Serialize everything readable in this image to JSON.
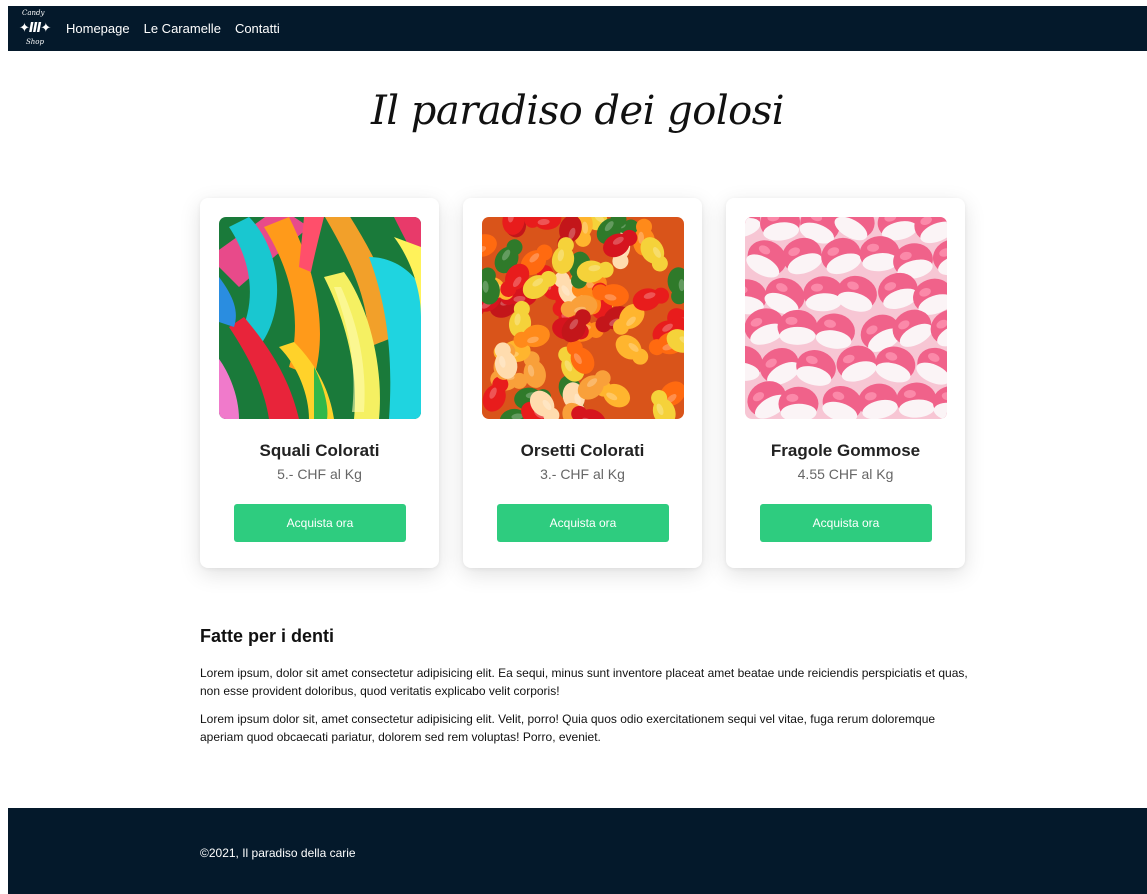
{
  "navbar": {
    "logo": {
      "top_text": "Candy",
      "bottom_text": "Shop",
      "mark": "✦III✦"
    },
    "links": [
      {
        "label": "Homepage"
      },
      {
        "label": "Le Caramelle"
      },
      {
        "label": "Contatti"
      }
    ],
    "background": "#04192b"
  },
  "hero": {
    "title": "Il paradiso dei golosi"
  },
  "products": [
    {
      "name": "Squali Colorati",
      "price": "5.- CHF al Kg",
      "button": "Acquista ora",
      "image": "colorful-gummy-sharks"
    },
    {
      "name": "Orsetti Colorati",
      "price": "3.- CHF al Kg",
      "button": "Acquista ora",
      "image": "colorful-gummy-bears"
    },
    {
      "name": "Fragole Gommose",
      "price": "4.55 CHF al Kg",
      "button": "Acquista ora",
      "image": "pink-white-strawberry-gummies"
    }
  ],
  "about": {
    "title": "Fatte per i denti",
    "paragraphs": [
      "Lorem ipsum, dolor sit amet consectetur adipisicing elit. Ea sequi, minus sunt inventore placeat amet beatae unde reiciendis perspiciatis et quas, non esse provident doloribus, quod veritatis explicabo velit corporis!",
      "Lorem ipsum dolor sit, amet consectetur adipisicing elit. Velit, porro! Quia quos odio exercitationem sequi vel vitae, fuga rerum doloremque aperiam quod obcaecati pariatur, dolorem sed rem voluptas! Porro, eveniet."
    ]
  },
  "footer": {
    "text": "©2021, Il paradiso della carie"
  },
  "colors": {
    "accent": "#2ecc7f",
    "dark": "#04192b"
  }
}
